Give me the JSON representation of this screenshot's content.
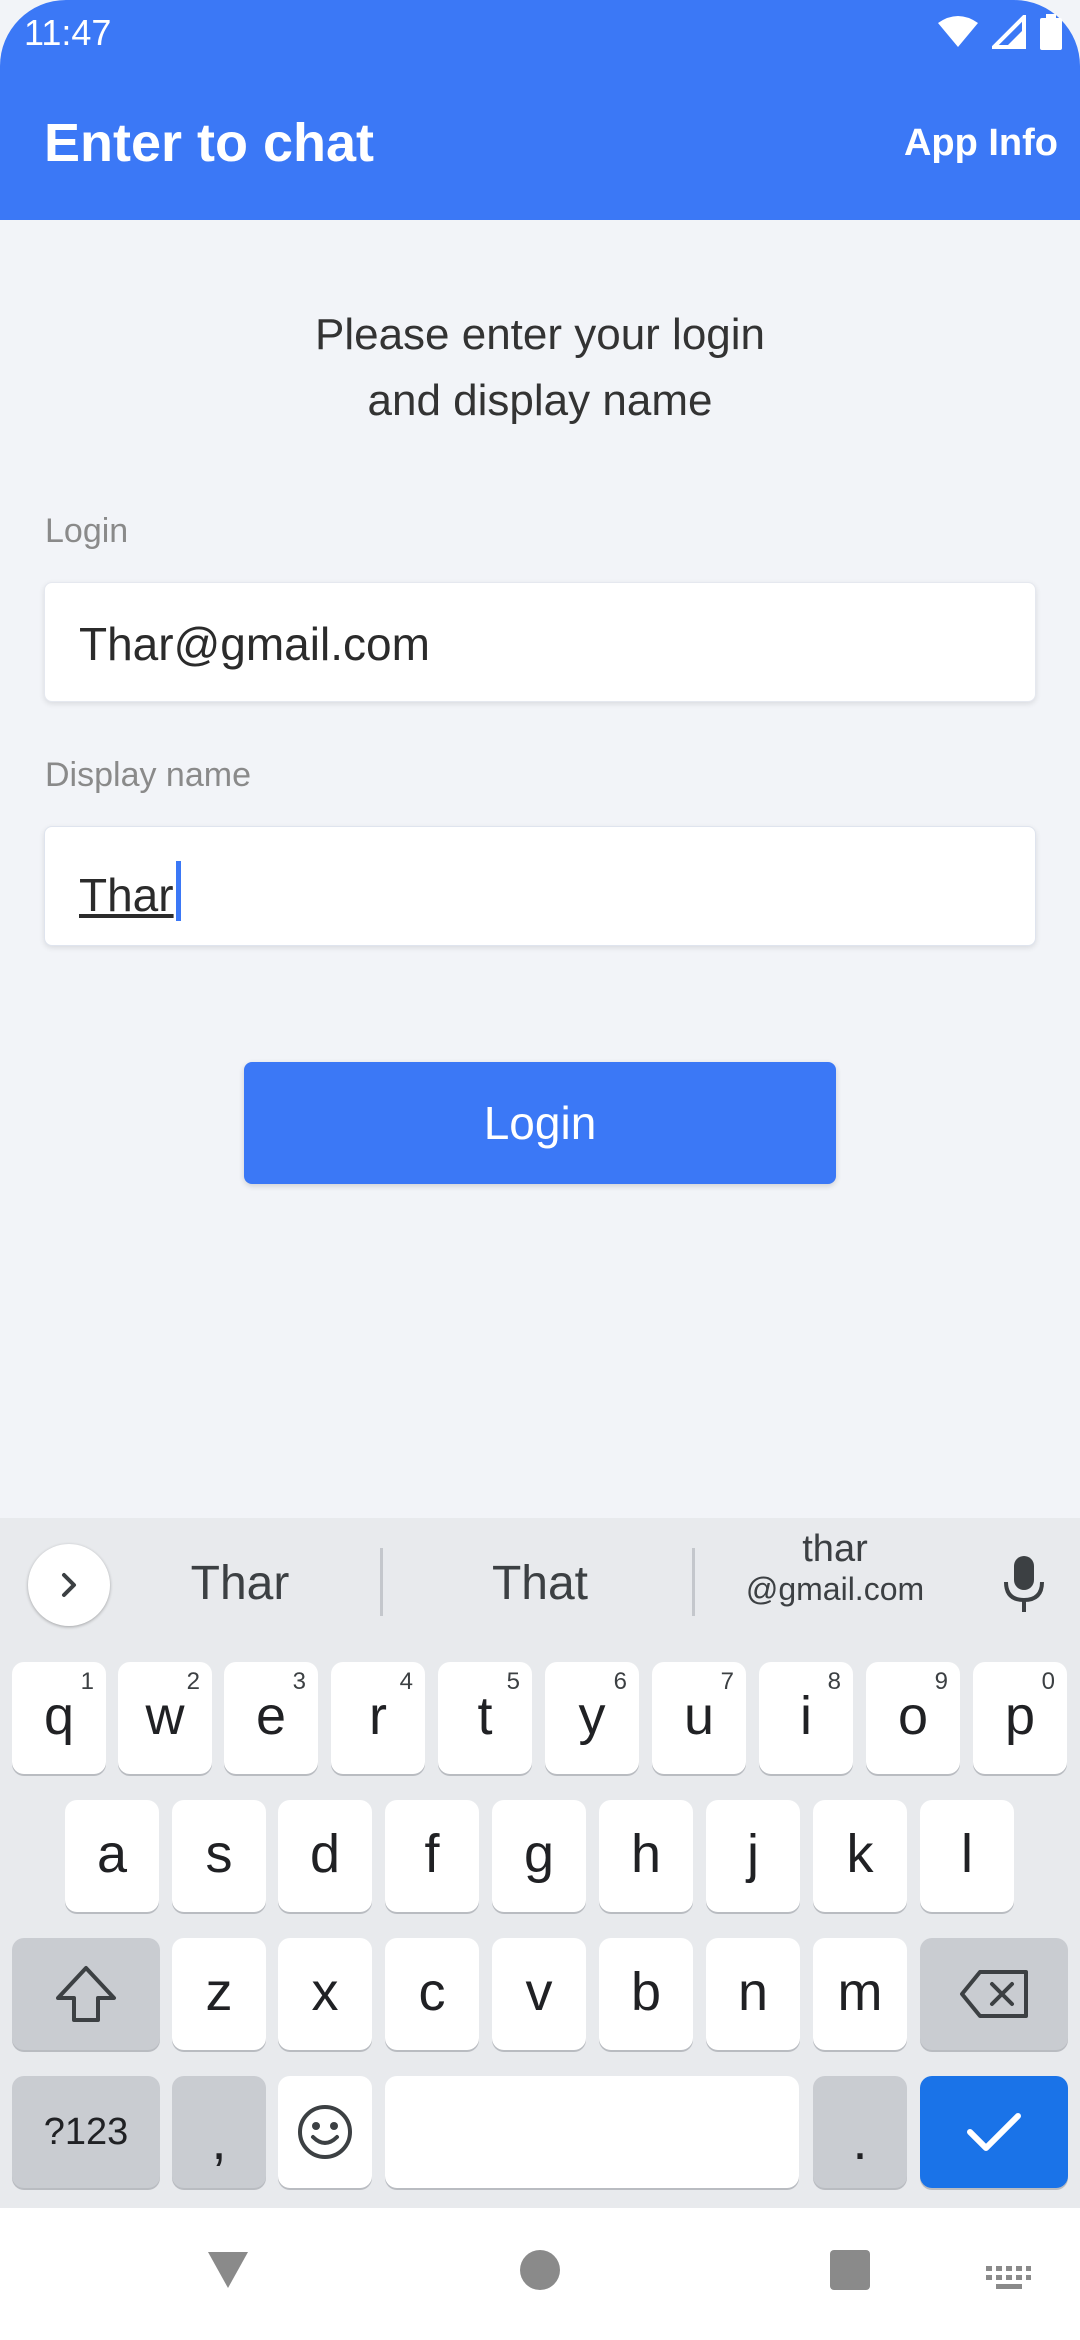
{
  "status_bar": {
    "time": "11:47",
    "icons": [
      "wifi-icon",
      "cell-signal-icon",
      "battery-icon"
    ]
  },
  "app_bar": {
    "title": "Enter to chat",
    "action": "App Info"
  },
  "instruction": {
    "line1": "Please enter your login",
    "line2": "and display name"
  },
  "login_field": {
    "label": "Login",
    "value": "Thar@gmail.com"
  },
  "display_name_field": {
    "label": "Display name",
    "value": "Thar"
  },
  "login_button": "Login",
  "keyboard": {
    "suggestions": [
      "Thar",
      "That"
    ],
    "email_suggestion": {
      "line1": "thar",
      "line2": "@gmail.com"
    },
    "row1": [
      {
        "k": "q",
        "h": "1"
      },
      {
        "k": "w",
        "h": "2"
      },
      {
        "k": "e",
        "h": "3"
      },
      {
        "k": "r",
        "h": "4"
      },
      {
        "k": "t",
        "h": "5"
      },
      {
        "k": "y",
        "h": "6"
      },
      {
        "k": "u",
        "h": "7"
      },
      {
        "k": "i",
        "h": "8"
      },
      {
        "k": "o",
        "h": "9"
      },
      {
        "k": "p",
        "h": "0"
      }
    ],
    "row2": [
      "a",
      "s",
      "d",
      "f",
      "g",
      "h",
      "j",
      "k",
      "l"
    ],
    "row3": [
      "z",
      "x",
      "c",
      "v",
      "b",
      "n",
      "m"
    ],
    "symbols_key": "?123",
    "comma_key": ",",
    "period_key": "."
  },
  "colors": {
    "primary": "#3b78f6",
    "enter_key": "#1a73e8",
    "background": "#f2f4f8"
  }
}
